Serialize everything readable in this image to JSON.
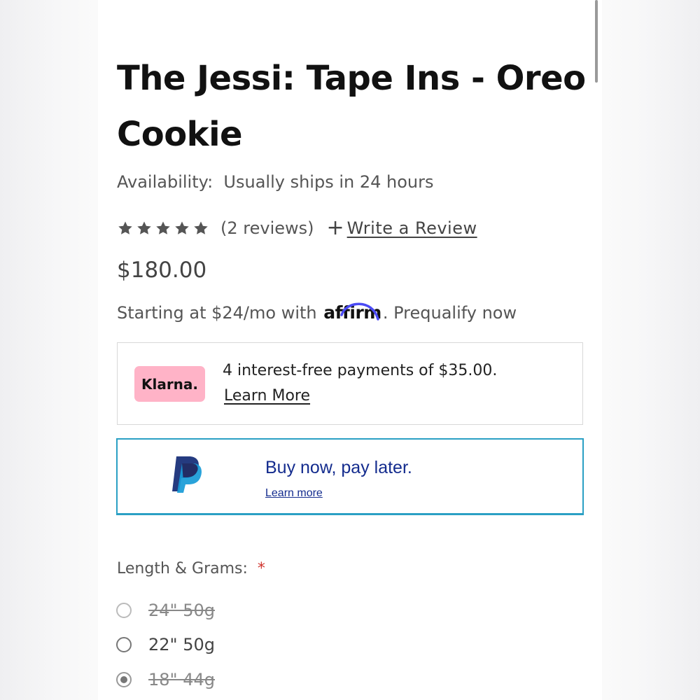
{
  "product": {
    "title": "The Jessi: Tape Ins - Oreo Cookie",
    "availability_label": "Availability:",
    "availability_value": "Usually ships in 24 hours",
    "rating": 5,
    "review_count_text": "(2 reviews)",
    "write_review_label": "Write a Review",
    "price": "$180.00"
  },
  "affirm": {
    "prefix": "Starting at $24/mo with ",
    "logo_text": "affirm",
    "link_text": ". Prequalify now",
    "arc_color": "#4a4af4"
  },
  "klarna": {
    "badge_text": "Klarna.",
    "message": "4 interest-free payments of $35.00.",
    "learn_more": "Learn More",
    "badge_color": "#ffb3c7"
  },
  "paypal": {
    "headline": "Buy now, pay later.",
    "learn_more": "Learn more",
    "icon": "paypal-icon",
    "text_color": "#142c8e",
    "border_color": "#2aa0c4"
  },
  "options": {
    "label": "Length & Grams:",
    "required_mark": "*",
    "items": [
      {
        "label": "24\" 50g",
        "selected": false,
        "disabled": true
      },
      {
        "label": "22\" 50g",
        "selected": false,
        "disabled": false
      },
      {
        "label": "18\" 44g",
        "selected": true,
        "disabled": true
      }
    ]
  }
}
